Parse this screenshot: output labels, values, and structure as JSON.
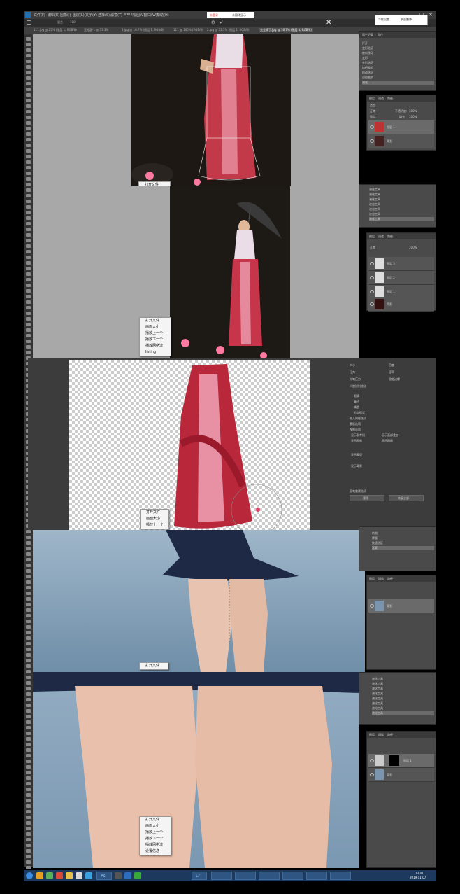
{
  "menubar": {
    "items": [
      "文件(F)",
      "编辑(E)",
      "图像(I)",
      "图层(L)",
      "文字(Y)",
      "选择(S)",
      "滤镜(T)",
      "3D(D)",
      "视图(V)",
      "窗口(W)",
      "帮助(H)"
    ],
    "popup": {
      "left_label": "未登录",
      "right_label": "未翻译显示"
    }
  },
  "optbar": {
    "mode_label": "混合",
    "value": "100"
  },
  "tabs": [
    "111.jpg @ 25% (图层 1, RGB/8)",
    "无标题-1 @ 33.3%",
    "1.jpg @ 16.7% (图层 1, RGB/8)",
    "111 @ 100% (RGB/8)",
    "2.jpg @ 33.3% (图层 1, RGB/8)",
    "完全摘了.jpg @ 16.7% (图层 1, RGB/8)"
  ],
  "top_right_popup": {
    "text1": "个性设置",
    "text2": "多面翻译"
  },
  "context_menus": [
    {
      "items": [
        "打开文件"
      ]
    },
    {
      "items": [
        "打开文件",
        "画面大小",
        "播放上一个",
        "播放下一个",
        "播放网络流",
        "listing"
      ]
    },
    {
      "items": [
        "打开文件",
        "画面大小",
        "播放上一个"
      ]
    },
    {
      "items": [
        "打开文件"
      ]
    },
    {
      "items": [
        "打开文件",
        "画面大小",
        "播放上一个",
        "播放下一个",
        "播放网络流",
        "设置信息"
      ]
    }
  ],
  "history_panel_1": {
    "tabs": [
      "历史记录",
      "动作"
    ],
    "items": [
      "历史记录",
      "打开",
      "变形选区",
      "定向移动",
      "变形",
      "变形选区",
      "执行裁剪",
      "移动选区",
      "自由变换",
      "液化"
    ]
  },
  "layers_panel": {
    "tabs": [
      "图层",
      "通道",
      "路径"
    ],
    "kind_label": "类型",
    "blend": "正常",
    "opacity_label": "不透明度:",
    "opacity": "100%",
    "lock_label": "锁定:",
    "fill_label": "填充:",
    "fill": "100%",
    "layers_a": [
      "图层 1",
      "背景"
    ],
    "layers_b": [
      "图层 3",
      "图层 2",
      "图层 1",
      "背景"
    ],
    "layers_c": [
      "背景"
    ],
    "layers_d": [
      "图层 1",
      "背景"
    ]
  },
  "history_panel_2": {
    "items": [
      "液化工具",
      "液化工具",
      "液化工具",
      "液化工具",
      "液化工具",
      "液化工具",
      "液化工具"
    ]
  },
  "history_panel_3": {
    "items": [
      "仿制",
      "蒙版",
      "快速选区",
      "套索"
    ]
  },
  "history_panel_4": {
    "items": [
      "液化工具",
      "液化工具",
      "液化工具",
      "液化工具",
      "液化工具",
      "液化工具",
      "液化工具",
      "液化工具"
    ]
  },
  "liquify_panel": {
    "labels": [
      "大小",
      "密度",
      "压力",
      "速率",
      "光笔压力",
      "固定边缘",
      "人脸识别液化",
      "眼睛",
      "鼻子",
      "嘴唇",
      "脸部形状",
      "载入网格选项",
      "蒙版选项",
      "视图选项",
      "显示参考线",
      "显示面部叠加",
      "显示图像",
      "显示网格",
      "显示蒙版",
      "显示背景",
      "画笔重建选项"
    ],
    "buttons": [
      "重建",
      "恢复全部"
    ]
  },
  "taskbar": {
    "clock_time": "13:41",
    "clock_date": "2019-11-07",
    "apps": [
      "",
      "",
      "Ps",
      "",
      "",
      "",
      "",
      "",
      "Lr",
      "",
      "",
      "",
      "",
      "",
      "",
      "",
      ""
    ]
  }
}
